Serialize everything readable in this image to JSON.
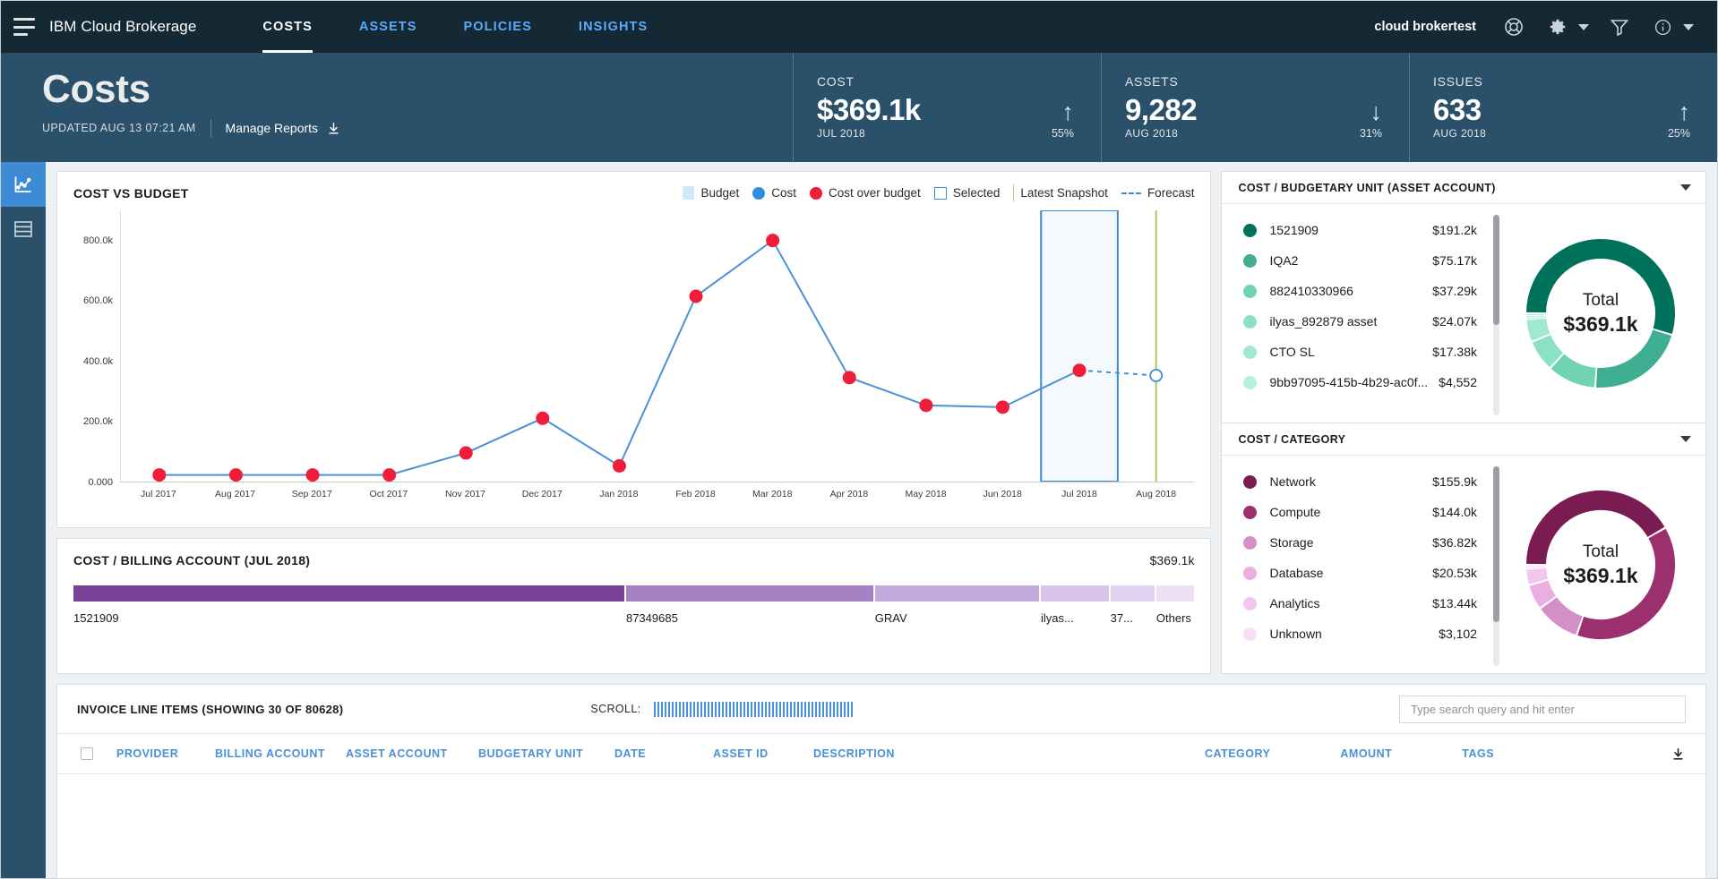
{
  "topnav": {
    "brand": "IBM Cloud Brokerage",
    "tabs": [
      {
        "label": "COSTS",
        "active": true
      },
      {
        "label": "ASSETS",
        "active": false
      },
      {
        "label": "POLICIES",
        "active": false
      },
      {
        "label": "INSIGHTS",
        "active": false
      }
    ],
    "account": "cloud brokertest",
    "icons": [
      "support-icon",
      "gear-icon",
      "filter-icon",
      "info-icon"
    ]
  },
  "page_header": {
    "title": "Costs",
    "updated": "UPDATED AUG 13 07:21 AM",
    "manage_reports": "Manage Reports",
    "kpis": [
      {
        "label": "COST",
        "value": "$369.1k",
        "period": "JUL 2018",
        "trend": "up",
        "arrow": "↑",
        "pct": "55%"
      },
      {
        "label": "ASSETS",
        "value": "9,282",
        "period": "AUG 2018",
        "trend": "down",
        "arrow": "↓",
        "pct": "31%"
      },
      {
        "label": "ISSUES",
        "value": "633",
        "period": "AUG 2018",
        "trend": "up",
        "arrow": "↑",
        "pct": "25%"
      }
    ]
  },
  "rail": {
    "items": [
      {
        "name": "chart-view",
        "active": true
      },
      {
        "name": "table-view",
        "active": false
      }
    ]
  },
  "cost_vs_budget": {
    "title": "COST VS BUDGET",
    "legend": [
      {
        "label": "Budget",
        "type": "square",
        "color": "#cfe9f7"
      },
      {
        "label": "Cost",
        "type": "dot",
        "color": "#2d8ede"
      },
      {
        "label": "Cost over budget",
        "type": "dot",
        "color": "#f01d3a"
      },
      {
        "label": "Selected",
        "type": "outline",
        "color": "#3d8bd4"
      },
      {
        "label": "Latest Snapshot",
        "type": "vline",
        "color": "#b9d37a"
      },
      {
        "label": "Forecast",
        "type": "dashed",
        "color": "#3d8bd4"
      }
    ]
  },
  "chart_data": {
    "type": "line",
    "title": "COST VS BUDGET",
    "xlabel": "",
    "ylabel": "",
    "grid": false,
    "ylim": [
      0,
      900000
    ],
    "yticks": [
      0,
      200000,
      400000,
      600000,
      800000
    ],
    "ytick_labels": [
      "0.000",
      "200.0k",
      "400.0k",
      "600.0k",
      "800.0k"
    ],
    "categories": [
      "Jul 2017",
      "Aug 2017",
      "Sep 2017",
      "Oct 2017",
      "Nov 2017",
      "Dec 2017",
      "Jan 2018",
      "Feb 2018",
      "Mar 2018",
      "Apr 2018",
      "May 2018",
      "Jun 2018",
      "Jul 2018",
      "Aug 2018"
    ],
    "series": [
      {
        "name": "Cost",
        "values": [
          22000,
          22000,
          22000,
          22000,
          95000,
          210000,
          52000,
          615000,
          800000,
          345000,
          253000,
          247000,
          369100,
          null
        ],
        "over_budget": [
          true,
          true,
          true,
          true,
          true,
          true,
          true,
          true,
          true,
          true,
          true,
          true,
          true,
          false
        ]
      },
      {
        "name": "Forecast",
        "values": [
          null,
          null,
          null,
          null,
          null,
          null,
          null,
          null,
          null,
          null,
          null,
          null,
          369100,
          352000
        ],
        "style": "dashed",
        "marker": "open-circle"
      }
    ],
    "annotations": [
      {
        "type": "selection-box",
        "from": "Jul 2018",
        "label": "Selected"
      },
      {
        "type": "vline",
        "at": "Aug 2018",
        "label": "Latest Snapshot",
        "color": "#b9d37a"
      }
    ],
    "legend_position": "top-right"
  },
  "billing_account": {
    "title": "COST / BILLING ACCOUNT (JUL 2018)",
    "total": "$369.1k",
    "segments": [
      {
        "label": "1521909",
        "pct": 49.3,
        "color": "#7b4397"
      },
      {
        "label": "87349685",
        "pct": 22.2,
        "color": "#a482c4"
      },
      {
        "label": "GRAV",
        "pct": 14.8,
        "color": "#c3a9dd"
      },
      {
        "label": "ilyas...",
        "pct": 6.2,
        "color": "#d9c5ea"
      },
      {
        "label": "37...",
        "pct": 4.1,
        "color": "#e3d3f0"
      },
      {
        "label": "Others",
        "pct": 3.4,
        "color": "#eee1f6"
      }
    ]
  },
  "cost_budgetary_unit": {
    "title": "COST / BUDGETARY UNIT (ASSET ACCOUNT)",
    "total_label": "Total",
    "total_value": "$369.1k",
    "items": [
      {
        "label": "1521909",
        "value": "$191.2k",
        "amount": 191200,
        "color": "#00725c"
      },
      {
        "label": "IQA2",
        "value": "$75.17k",
        "amount": 75170,
        "color": "#3fae92"
      },
      {
        "label": "882410330966",
        "value": "$37.29k",
        "amount": 37290,
        "color": "#6fd3b4"
      },
      {
        "label": "ilyas_892879 asset",
        "value": "$24.07k",
        "amount": 24070,
        "color": "#8ce0c6"
      },
      {
        "label": "CTO SL",
        "value": "$17.38k",
        "amount": 17380,
        "color": "#9fe8d2"
      },
      {
        "label": "9bb97095-415b-4b29-ac0f...",
        "value": "$4,552",
        "amount": 4552,
        "color": "#b5f0de"
      }
    ]
  },
  "cost_category": {
    "title": "COST / CATEGORY",
    "total_label": "Total",
    "total_value": "$369.1k",
    "items": [
      {
        "label": "Network",
        "value": "$155.9k",
        "amount": 155900,
        "color": "#7a1c52"
      },
      {
        "label": "Compute",
        "value": "$144.0k",
        "amount": 144000,
        "color": "#9c2f6e"
      },
      {
        "label": "Storage",
        "value": "$36.82k",
        "amount": 36820,
        "color": "#d490c4"
      },
      {
        "label": "Database",
        "value": "$20.53k",
        "amount": 20530,
        "color": "#eaaee0"
      },
      {
        "label": "Analytics",
        "value": "$13.44k",
        "amount": 13440,
        "color": "#f3c6ef"
      },
      {
        "label": "Unknown",
        "value": "$3,102",
        "amount": 3102,
        "color": "#fbddf7"
      }
    ]
  },
  "invoice_table": {
    "title": "INVOICE LINE ITEMS (SHOWING 30 OF 80628)",
    "scroll_label": "SCROLL:",
    "search_placeholder": "Type search query and hit enter",
    "search_value": "",
    "columns": [
      "PROVIDER",
      "BILLING ACCOUNT",
      "ASSET ACCOUNT",
      "BUDGETARY UNIT",
      "DATE",
      "ASSET ID",
      "DESCRIPTION",
      "CATEGORY",
      "AMOUNT",
      "TAGS"
    ]
  }
}
